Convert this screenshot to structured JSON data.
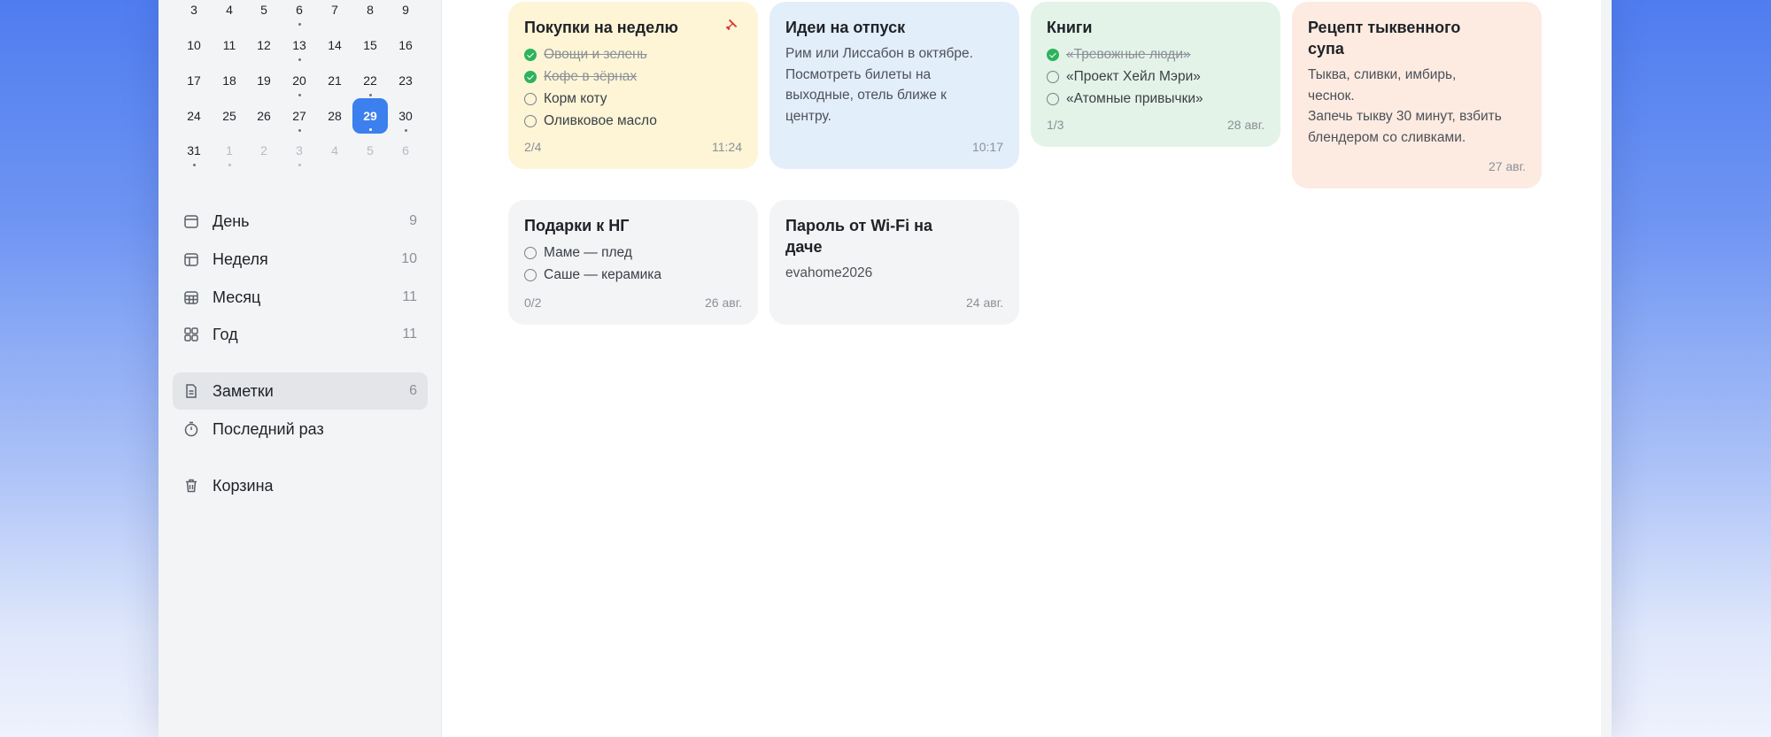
{
  "calendar": {
    "rows": [
      [
        {
          "d": "3",
          "dot": false
        },
        {
          "d": "4",
          "dot": false
        },
        {
          "d": "5",
          "dot": false
        },
        {
          "d": "6",
          "dot": true
        },
        {
          "d": "7",
          "dot": false
        },
        {
          "d": "8",
          "dot": false
        },
        {
          "d": "9",
          "dot": false
        }
      ],
      [
        {
          "d": "10",
          "dot": false
        },
        {
          "d": "11",
          "dot": false
        },
        {
          "d": "12",
          "dot": false
        },
        {
          "d": "13",
          "dot": true
        },
        {
          "d": "14",
          "dot": false
        },
        {
          "d": "15",
          "dot": false
        },
        {
          "d": "16",
          "dot": false
        }
      ],
      [
        {
          "d": "17",
          "dot": false
        },
        {
          "d": "18",
          "dot": false
        },
        {
          "d": "19",
          "dot": false
        },
        {
          "d": "20",
          "dot": true
        },
        {
          "d": "21",
          "dot": false
        },
        {
          "d": "22",
          "dot": true
        },
        {
          "d": "23",
          "dot": false
        }
      ],
      [
        {
          "d": "24",
          "dot": false
        },
        {
          "d": "25",
          "dot": false
        },
        {
          "d": "26",
          "dot": false
        },
        {
          "d": "27",
          "dot": true
        },
        {
          "d": "28",
          "dot": false
        },
        {
          "d": "29",
          "dot": true,
          "today": true
        },
        {
          "d": "30",
          "dot": true
        }
      ],
      [
        {
          "d": "31",
          "dot": true
        },
        {
          "d": "1",
          "dot": true,
          "dim": true
        },
        {
          "d": "2",
          "dot": false,
          "dim": true
        },
        {
          "d": "3",
          "dot": true,
          "dim": true
        },
        {
          "d": "4",
          "dot": false,
          "dim": true
        },
        {
          "d": "5",
          "dot": false,
          "dim": true
        },
        {
          "d": "6",
          "dot": false,
          "dim": true
        }
      ]
    ]
  },
  "nav": {
    "day": {
      "label": "День",
      "count": "9",
      "icon": "calendar-day-icon"
    },
    "week": {
      "label": "Неделя",
      "count": "10",
      "icon": "calendar-week-icon"
    },
    "month": {
      "label": "Месяц",
      "count": "11",
      "icon": "calendar-month-icon"
    },
    "year": {
      "label": "Год",
      "count": "11",
      "icon": "grid-icon"
    },
    "notes": {
      "label": "Заметки",
      "count": "6",
      "icon": "document-icon"
    },
    "recent": {
      "label": "Последний раз",
      "icon": "clock-icon"
    },
    "trash": {
      "label": "Корзина",
      "icon": "trash-icon"
    }
  },
  "notes": [
    {
      "title": "Покупки на неделю",
      "pinned": true,
      "bg": "#fdf5d6",
      "items": [
        {
          "text": "Овощи и зелень",
          "done": true
        },
        {
          "text": "Кофе в зёрнах",
          "done": true
        },
        {
          "text": "Корм коту",
          "done": false
        },
        {
          "text": "Оливковое масло",
          "done": false
        }
      ],
      "progress": "2/4",
      "date": "11:24"
    },
    {
      "title": "Идеи на отпуск",
      "bg": "#e3eefb",
      "body": "Рим или Лиссабон в октябре.\nПосмотреть билеты на\nвыходные, отель ближе к\nцентру.",
      "date": "10:17"
    },
    {
      "title": "Книги",
      "bg": "#e3f3e8",
      "items": [
        {
          "text": "«Тревожные люди»",
          "done": true
        },
        {
          "text": "«Проект Хейл Мэри»",
          "done": false
        },
        {
          "text": "«Атомные привычки»",
          "done": false
        }
      ],
      "progress": "1/3",
      "date": "28 авг."
    },
    {
      "title": "Рецепт тыквенного\nсупа",
      "bg": "#fdebe1",
      "body": "Тыква, сливки, имбирь,\nчеснок.\nЗапечь тыкву 30 минут, взбить\nблендером со сливками.",
      "date": "27 авг."
    },
    {
      "title": "Подарки к НГ",
      "bg": "#f3f4f6",
      "items": [
        {
          "text": "Маме — плед",
          "done": false
        },
        {
          "text": "Саше — керамика",
          "done": false
        }
      ],
      "progress": "0/2",
      "date": "26 авг."
    },
    {
      "title": "Пароль от Wi-Fi на\nдаче",
      "bg": "#f3f4f6",
      "body": "evahome2026",
      "date": "24 авг."
    }
  ]
}
